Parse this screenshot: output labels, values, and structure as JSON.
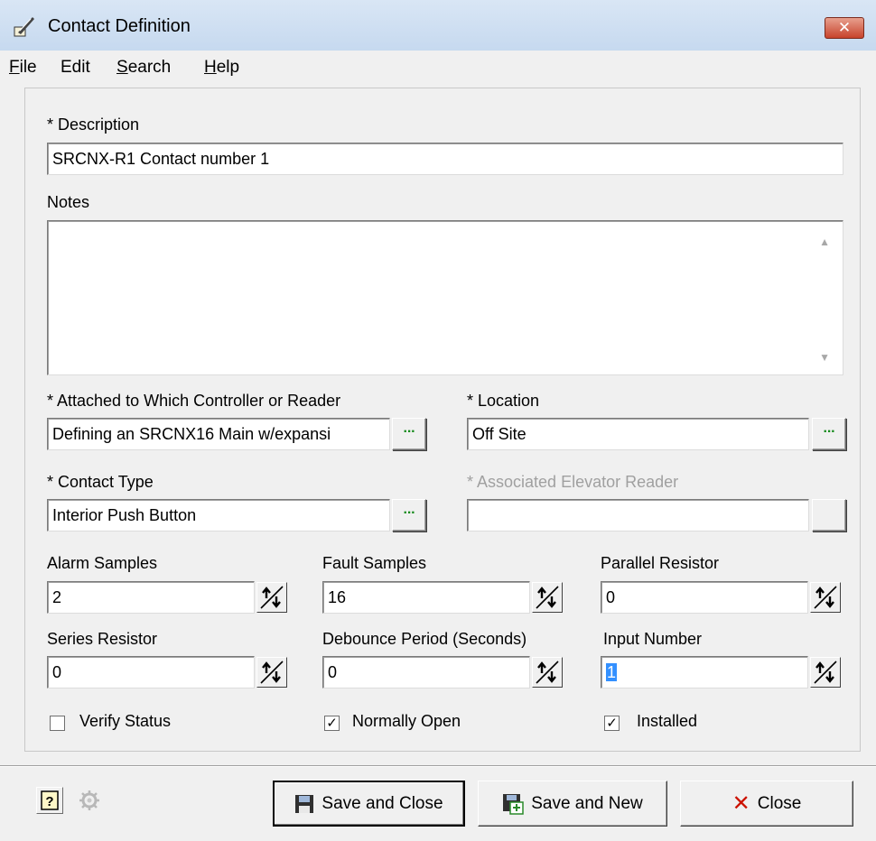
{
  "window": {
    "title": "Contact Definition",
    "close_glyph": "✕",
    "icon": "quill-pen-icon"
  },
  "menu": [
    {
      "label": "File",
      "mnemonic": "F",
      "rest": "ile"
    },
    {
      "label": "Edit",
      "mnemonic": "",
      "rest": "Edit"
    },
    {
      "label": "Search",
      "mnemonic": "S",
      "rest": "earch"
    },
    {
      "label": "Help",
      "mnemonic": "H",
      "rest": "elp"
    }
  ],
  "form": {
    "description": {
      "label": "* Description",
      "value": "SRCNX-R1 Contact number 1"
    },
    "notes": {
      "label": "Notes",
      "value": ""
    },
    "controller": {
      "label": "* Attached to Which Controller or Reader",
      "value": "Defining an SRCNX16 Main w/expansi"
    },
    "location": {
      "label": "* Location",
      "value": "Off Site"
    },
    "contact_type": {
      "label": "* Contact Type",
      "value": "Interior Push Button"
    },
    "elevator_reader": {
      "label": "* Associated Elevator Reader",
      "value": "",
      "disabled": true
    },
    "alarm_samples": {
      "label": "Alarm Samples",
      "value": "2"
    },
    "fault_samples": {
      "label": "Fault Samples",
      "value": "16"
    },
    "parallel_resistor": {
      "label": "Parallel Resistor",
      "value": "0"
    },
    "series_resistor": {
      "label": "Series Resistor",
      "value": "0"
    },
    "debounce_period": {
      "label": "Debounce Period (Seconds)",
      "value": "0"
    },
    "input_number": {
      "label": "Input Number",
      "value": "1"
    },
    "verify_status": {
      "label": "Verify Status",
      "checked": false
    },
    "normally_open": {
      "label": "Normally Open",
      "checked": true
    },
    "installed": {
      "label": "Installed",
      "checked": true
    },
    "browse_label": "···"
  },
  "footer": {
    "help_icon": "question-mark-icon",
    "wizard_icon": "gear-icon",
    "save_close_label": "Save and Close",
    "save_new_label": "Save and New",
    "close_label": "Close",
    "help_glyph": "?",
    "check_glyph": "✓",
    "close_glyph": "✕"
  },
  "colors": {
    "title_bar": "#c6d9ef",
    "close_button": "#c7432c",
    "browse_dots": "#158a1c",
    "selection": "#3390ff",
    "close_icon": "#cc1100"
  }
}
